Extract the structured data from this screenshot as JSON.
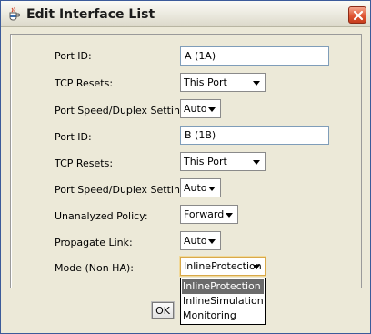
{
  "window": {
    "title": "Edit Interface List"
  },
  "fields": [
    {
      "label": "Port ID:",
      "value": "A (1A)"
    },
    {
      "label": "TCP Resets:",
      "value": "This Port"
    },
    {
      "label": "Port Speed/Duplex Settings:",
      "value": "Auto"
    },
    {
      "label": "Port ID:",
      "value": "B (1B)"
    },
    {
      "label": "TCP Resets:",
      "value": "This Port"
    },
    {
      "label": "Port Speed/Duplex Settings:",
      "value": "Auto"
    },
    {
      "label": "Unanalyzed Policy:",
      "value": "Forward"
    },
    {
      "label": "Propagate Link:",
      "value": "Auto"
    },
    {
      "label": "Mode (Non HA):",
      "value": "InlineProtection"
    }
  ],
  "mode_dropdown": {
    "options": [
      "InlineProtection",
      "InlineSimulation",
      "Monitoring"
    ],
    "selected": "InlineProtection"
  },
  "buttons": {
    "ok": "OK"
  },
  "icons": {
    "app": "java-cup-icon",
    "close": "close-icon",
    "combo_arrow": "chevron-down-icon"
  }
}
